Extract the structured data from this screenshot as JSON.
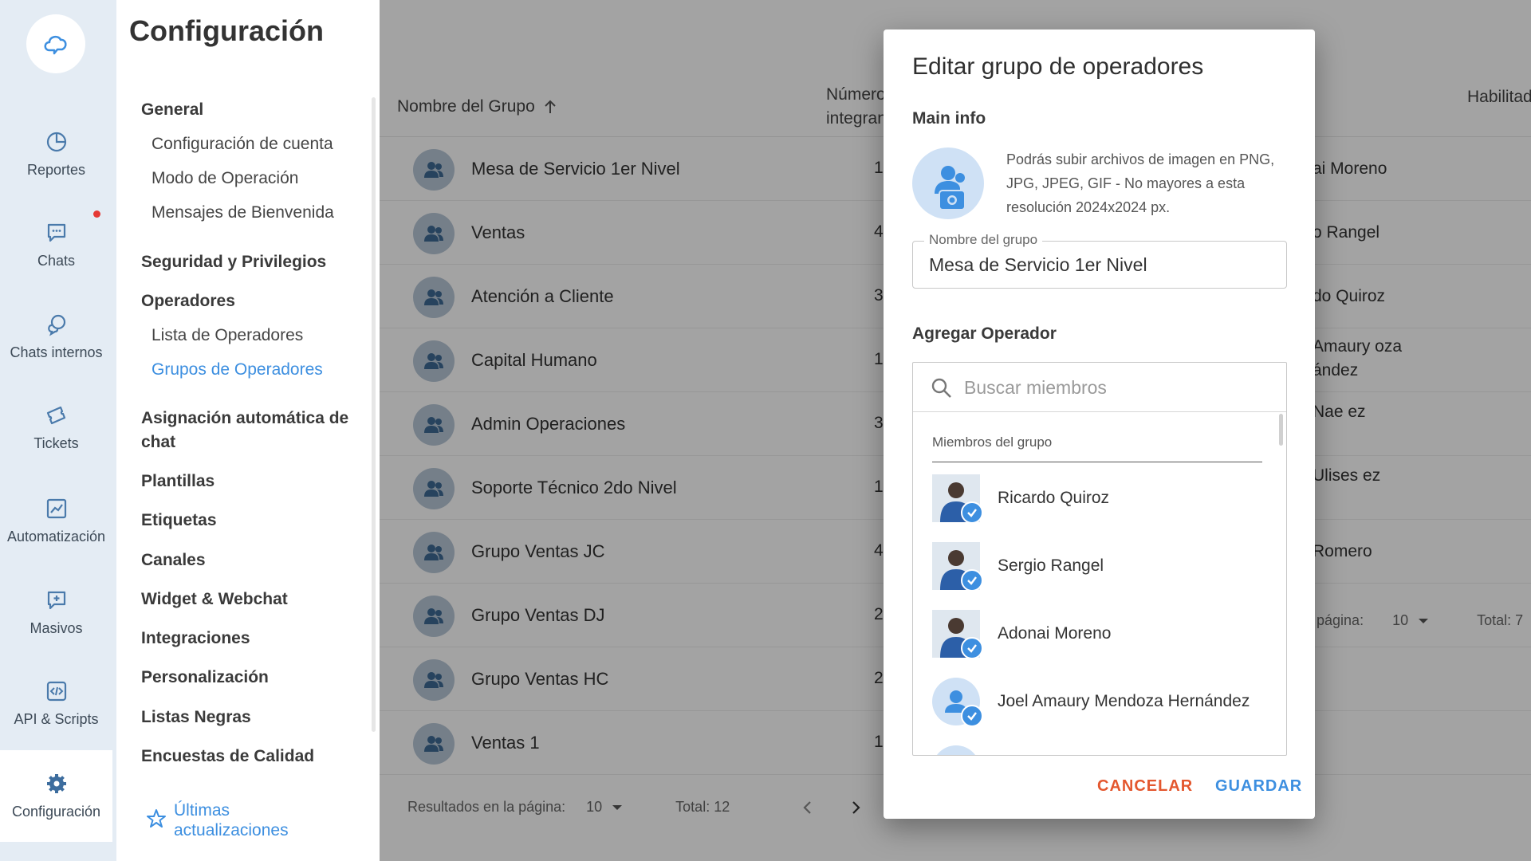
{
  "rail": {
    "items": [
      {
        "label": "Reportes",
        "icon": "pie-chart-icon"
      },
      {
        "label": "Chats",
        "icon": "chat-icon"
      },
      {
        "label": "Chats internos",
        "icon": "internal-chat-icon"
      },
      {
        "label": "Tickets",
        "icon": "ticket-icon"
      },
      {
        "label": "Automatización",
        "icon": "automation-icon"
      },
      {
        "label": "Masivos",
        "icon": "broadcast-icon"
      },
      {
        "label": "API & Scripts",
        "icon": "code-icon"
      },
      {
        "label": "Configuración",
        "icon": "gear-icon"
      }
    ]
  },
  "settings": {
    "title": "Configuración",
    "groups": {
      "general": "General",
      "seguridad": "Seguridad y Privilegios",
      "operadores": "Operadores",
      "asignacion": "Asignación automática de chat",
      "plantillas": "Plantillas",
      "etiquetas": "Etiquetas",
      "canales": "Canales",
      "widget": "Widget & Webchat",
      "integraciones": "Integraciones",
      "personalizacion": "Personalización",
      "listas_negras": "Listas Negras",
      "encuestas": "Encuestas de Calidad"
    },
    "sub": {
      "config_cuenta": "Configuración de cuenta",
      "modo_operacion": "Modo de Operación",
      "mensajes_bienvenida": "Mensajes de Bienvenida",
      "lista_operadores": "Lista de Operadores",
      "grupos_operadores": "Grupos de Operadores"
    },
    "updates": "Últimas actualizaciones"
  },
  "table": {
    "col_name": "Nombre del Grupo",
    "col_num": "Número de integrantes",
    "col_hab": "Habilitado",
    "rows": [
      {
        "name": "Mesa de Servicio 1er Nivel",
        "count": "1",
        "sup": "ai Moreno"
      },
      {
        "name": "Ventas",
        "count": "4",
        "sup": "o Rangel"
      },
      {
        "name": "Atención a Cliente",
        "count": "3",
        "sup": "do Quiroz"
      },
      {
        "name": "Capital Humano",
        "count": "1",
        "sup": "Amaury oza ández"
      },
      {
        "name": "Admin Operaciones",
        "count": "3",
        "sup": "Nae ez"
      },
      {
        "name": "Soporte Técnico 2do Nivel",
        "count": "1",
        "sup": "Ulises ez"
      },
      {
        "name": "Grupo Ventas JC",
        "count": "4",
        "sup": "Romero"
      },
      {
        "name": "Grupo Ventas DJ",
        "count": "2",
        "sup": ""
      },
      {
        "name": "Grupo Ventas HC",
        "count": "2",
        "sup": ""
      },
      {
        "name": "Ventas 1",
        "count": "1",
        "sup": ""
      }
    ],
    "pager": {
      "label": "Resultados en la página:",
      "size": "10",
      "total": "Total: 12"
    },
    "pager2": {
      "label": "a página:",
      "size": "10",
      "total": "Total: 7"
    }
  },
  "modal": {
    "title": "Editar grupo de operadores",
    "main_info": "Main info",
    "photo_hint": "Podrás subir archivos de imagen en PNG, JPG, JPEG, GIF - No mayores a esta resolución 2024x2024 px.",
    "name_label": "Nombre del grupo",
    "name_value": "Mesa de Servicio 1er Nivel",
    "add_operator": "Agregar Operador",
    "search_placeholder": "Buscar miembros",
    "members_header": "Miembros del grupo",
    "members": [
      {
        "name": "Ricardo Quiroz",
        "photo": true
      },
      {
        "name": "Sergio Rangel",
        "photo": true
      },
      {
        "name": "Adonai Moreno",
        "photo": true
      },
      {
        "name": "Joel Amaury Mendoza Hernández",
        "photo": false
      }
    ],
    "cancel": "CANCELAR",
    "save": "GUARDAR"
  },
  "colors": {
    "accent": "#3d8fe0",
    "cancel": "#e4572e",
    "rail": "#e4ecf4"
  }
}
